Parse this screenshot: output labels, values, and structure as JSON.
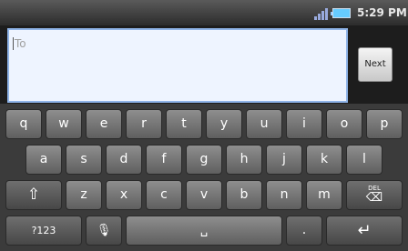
{
  "status_bar": {
    "time": "5:29 PM"
  },
  "compose": {
    "to_placeholder": "To",
    "next_label": "Next"
  },
  "keyboard": {
    "row1": [
      "q",
      "w",
      "e",
      "r",
      "t",
      "y",
      "u",
      "i",
      "o",
      "p"
    ],
    "row2": [
      "a",
      "s",
      "d",
      "f",
      "g",
      "h",
      "j",
      "k",
      "l"
    ],
    "row3": [
      "z",
      "x",
      "c",
      "v",
      "b",
      "n",
      "m"
    ],
    "shift_symbol": "⇧",
    "delete_label": "DEL",
    "symbols_label": "?123",
    "mic_symbol": "🎙",
    "space_symbol": "␣",
    "period_label": ".",
    "enter_symbol": "↵"
  }
}
